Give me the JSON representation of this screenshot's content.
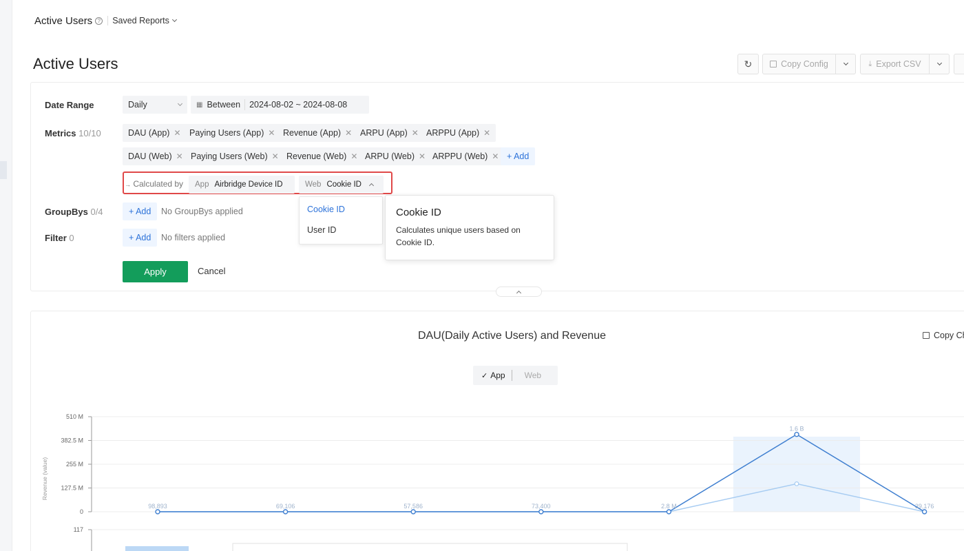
{
  "topbar": {
    "title": "Active Users",
    "saved_reports": "Saved Reports"
  },
  "page_title": "Active Users",
  "toolbar": {
    "copy_config": "Copy Config",
    "export_csv": "Export CSV"
  },
  "filters": {
    "date_range": {
      "label": "Date Range",
      "granularity": "Daily",
      "mode": "Between",
      "range": "2024-08-02 ~ 2024-08-08"
    },
    "metrics": {
      "label": "Metrics",
      "count": "10/10",
      "row1": [
        "DAU (App)",
        "Paying Users (App)",
        "Revenue (App)",
        "ARPU (App)",
        "ARPPU (App)"
      ],
      "row2": [
        "DAU (Web)",
        "Paying Users (Web)",
        "Revenue (Web)",
        "ARPU (Web)",
        "ARPPU (Web)"
      ],
      "add_label": "+ Add"
    },
    "calculated_by": {
      "label": "Calculated by",
      "app_key": "App",
      "app_value": "Airbridge Device ID",
      "web_key": "Web",
      "web_value": "Cookie ID"
    },
    "groupbys": {
      "label": "GroupBys",
      "count": "0/4",
      "add_label": "+ Add",
      "empty": "No GroupBys applied"
    },
    "filter": {
      "label": "Filter",
      "count": "0",
      "add_label": "+ Add",
      "empty": "No filters applied"
    },
    "apply": "Apply",
    "cancel": "Cancel"
  },
  "dropdown": {
    "options": [
      "Cookie ID",
      "User ID"
    ],
    "selected": "Cookie ID"
  },
  "tooltip": {
    "title": "Cookie ID",
    "body_line1": "Calculates unique users based on",
    "body_line2": "Cookie ID."
  },
  "chart_panel": {
    "title": "DAU(Daily Active Users) and Revenue",
    "copy_chart": "Copy Ch",
    "toggle_app": "App",
    "toggle_web": "Web"
  },
  "chart_data": {
    "type": "line",
    "ylabel": "Revenue (value)",
    "y_ticks": [
      "510 M",
      "382.5 M",
      "255 M",
      "127.5 M",
      "0"
    ],
    "ylim": [
      0,
      510000000
    ],
    "lower_axis_tick": "117",
    "points": 7,
    "highlight_index": 5,
    "series": [
      {
        "name": "App",
        "values": [
          0,
          0,
          0,
          0,
          0,
          415000000,
          0
        ],
        "labels": [
          "98,893",
          "69,106",
          "57,586",
          "73,400",
          "2.8 M",
          "1.6 B",
          "39,176"
        ]
      },
      {
        "values": [
          0,
          0,
          0,
          0,
          0,
          150000000,
          0
        ]
      }
    ],
    "colors": {
      "main": "#3f7fd0",
      "secondary": "#a7ccf2",
      "highlight": "#eaf3fd"
    }
  }
}
